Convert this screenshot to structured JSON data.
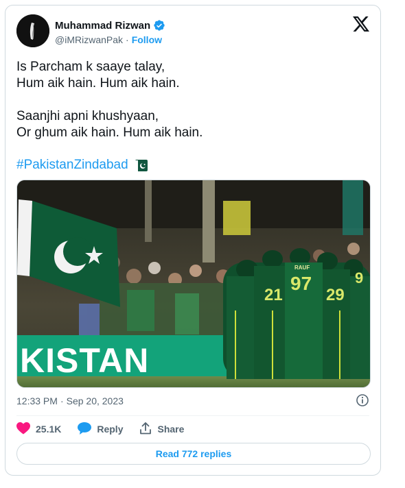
{
  "author": {
    "name": "Muhammad Rizwan",
    "handle": "@iMRizwanPak",
    "separator": "·",
    "follow_label": "Follow"
  },
  "tweet": {
    "text": "Is Parcham k saaye talay,\nHum aik hain. Hum aik hain.\n\nSaanjhi apni khushyaan,\nOr ghum aik hain. Hum aik hain.",
    "hashtag": "#PakistanZindabad",
    "emoji": "pakistan-flag-emoji"
  },
  "photo": {
    "board_text": "KISTAN",
    "jersey_numbers": [
      "97",
      "21",
      "29",
      "9"
    ],
    "jersey_name": "RAUF"
  },
  "meta": {
    "time": "12:33 PM",
    "separator": "·",
    "date": "Sep 20, 2023"
  },
  "actions": {
    "like_count": "25.1K",
    "reply_label": "Reply",
    "share_label": "Share"
  },
  "read_replies_label": "Read 772 replies",
  "colors": {
    "accent": "#1d9bf0",
    "like": "#f91880",
    "text": "#0f1419",
    "muted": "#536471",
    "border": "#cfd9de"
  }
}
